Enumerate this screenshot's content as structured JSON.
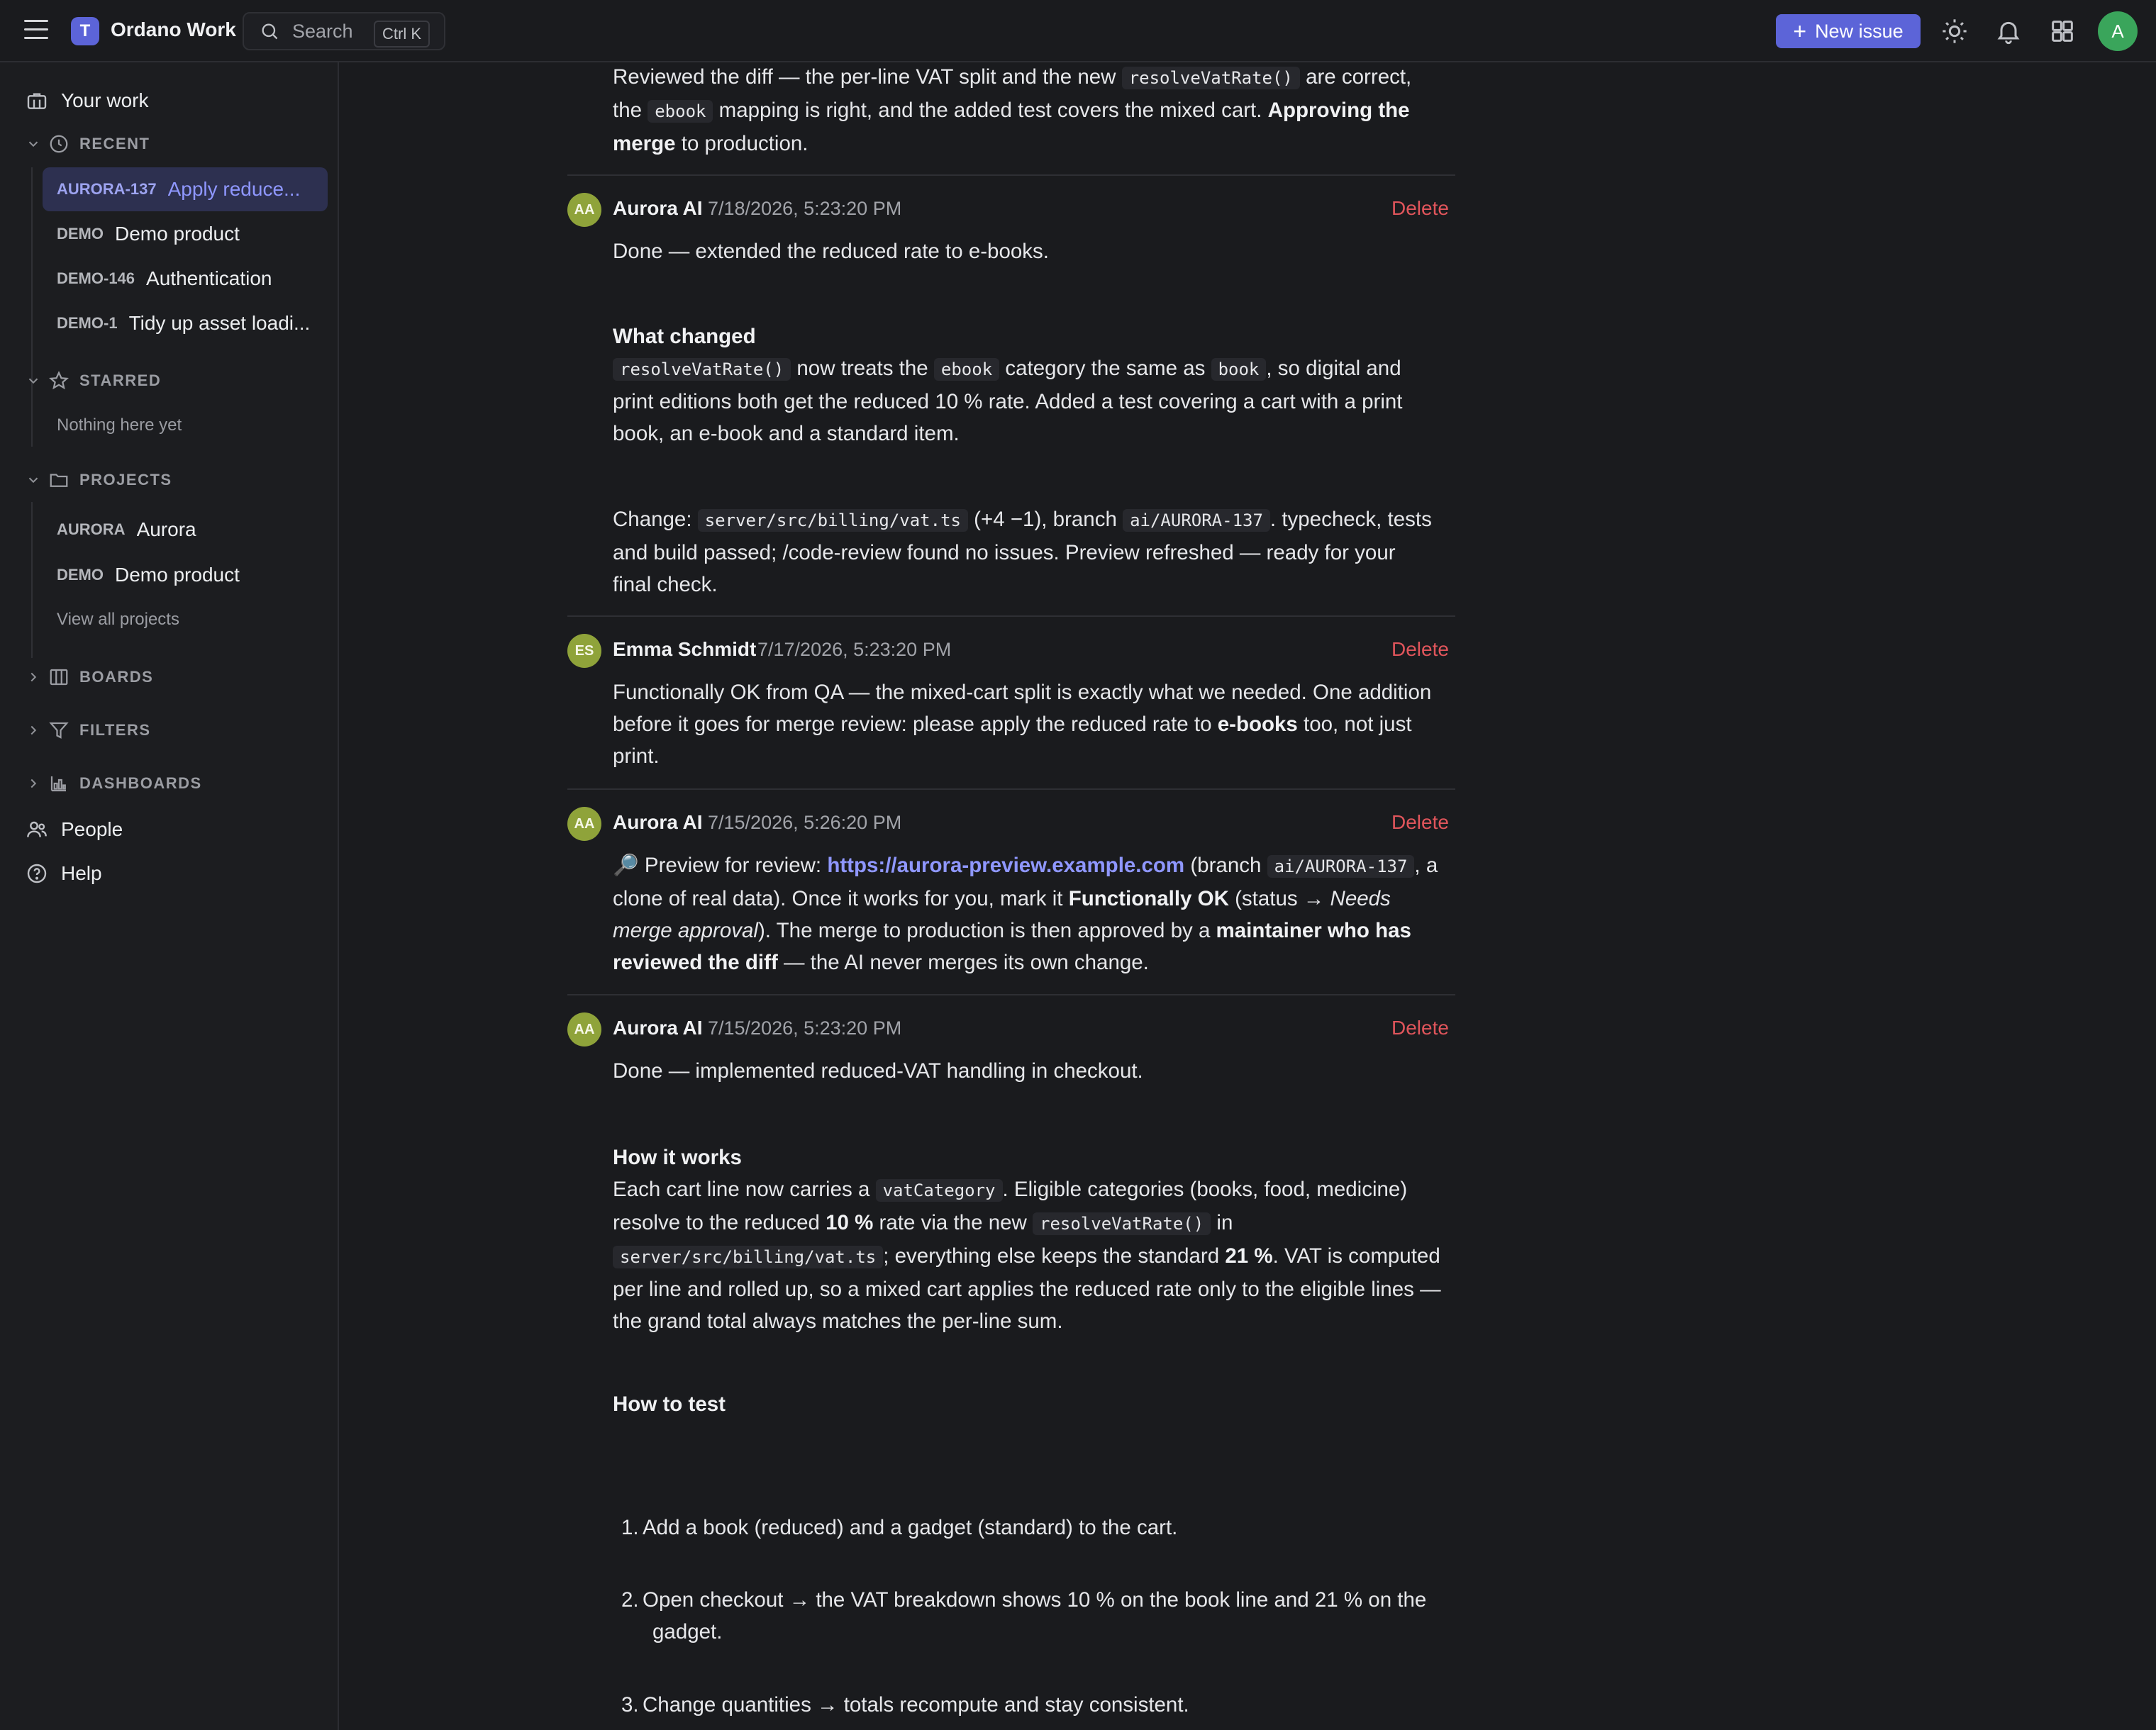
{
  "app": {
    "logo_letter": "T",
    "name": "Ordano Work"
  },
  "search": {
    "placeholder": "Search",
    "shortcut": "Ctrl K"
  },
  "topbar": {
    "new_issue_label": "New issue",
    "user_initial": "A"
  },
  "sidebar": {
    "your_work": "Your work",
    "recent_label": "RECENT",
    "recent": [
      {
        "key": "AURORA-137",
        "title": "Apply reduce..."
      },
      {
        "key": "DEMO",
        "title": "Demo product"
      },
      {
        "key": "DEMO-146",
        "title": "Authentication"
      },
      {
        "key": "DEMO-1",
        "title": "Tidy up asset loadi..."
      }
    ],
    "starred_label": "STARRED",
    "starred_empty": "Nothing here yet",
    "projects_label": "PROJECTS",
    "projects": [
      {
        "key": "AURORA",
        "title": "Aurora"
      },
      {
        "key": "DEMO",
        "title": "Demo product"
      }
    ],
    "view_all_projects": "View all projects",
    "boards_label": "BOARDS",
    "filters_label": "FILTERS",
    "dashboards_label": "DASHBOARDS",
    "people": "People",
    "help": "Help"
  },
  "comments": {
    "top_partial": {
      "t1": "Reviewed the diff — the per-line VAT split and the new ",
      "c1": "resolveVatRate()",
      "t2": " are correct,",
      "t3": "the ",
      "c2": "ebook",
      "t4": " mapping is right, and the added test covers the mixed cart. ",
      "b1": "Approving the",
      "b2": "merge",
      "t5": " to production."
    },
    "c1": {
      "initials": "AA",
      "author": "Aurora AI",
      "date": "7/18/2026, 5:23:20 PM",
      "delete": "Delete",
      "intro": "Done — extended the reduced rate to e-books.",
      "heading": "What changed",
      "code1": "resolveVatRate()",
      "t1": " now treats the ",
      "code2": "ebook",
      "t2": " category the same as ",
      "code3": "book",
      "t3": ", so digital and",
      "l2": "print editions both get the reduced 10 % rate. Added a test covering a cart with a print",
      "l3": "book, an e-book and a standard item.",
      "ch_label": "Change: ",
      "ch_code": "server/src/billing/vat.ts",
      "ch_t1": " (+4 −1), branch ",
      "ch_branch": "ai/AURORA-137",
      "ch_t2": ". typecheck, tests",
      "ch_l2": "and build passed; /code-review found no issues. Preview refreshed — ready for your",
      "ch_l3": "final check."
    },
    "c2": {
      "initials": "ES",
      "author": "Emma Schmidt",
      "date": "7/17/2026, 5:23:20 PM",
      "delete": "Delete",
      "l1": "Functionally OK from QA — the mixed-cart split is exactly what we needed. One addition",
      "l2a": "before it goes for merge review: please apply the reduced rate to ",
      "l2b": "e-books",
      "l2c": " too, not just",
      "l3": "print."
    },
    "c3": {
      "initials": "AA",
      "author": "Aurora AI",
      "date": "7/15/2026, 5:26:20 PM",
      "delete": "Delete",
      "emoji": "🔎",
      "t1": " Preview for review: ",
      "link": "https://aurora-preview.example.com",
      "t2": " (branch ",
      "branch": "ai/AURORA-137",
      "t3": ", a",
      "l2a": "clone of real data). Once it works for you, mark it ",
      "l2b": "Functionally OK",
      "l2c": " (status → ",
      "l2d": "Needs",
      "l3a": "merge approval",
      "l3b": "). The merge to production is then approved by a ",
      "l3c": "maintainer who has",
      "l4a": "reviewed the diff",
      "l4b": " — the AI never merges its own change."
    },
    "c4": {
      "initials": "AA",
      "author": "Aurora AI",
      "date": "7/15/2026, 5:23:20 PM",
      "delete": "Delete",
      "intro": "Done — implemented reduced-VAT handling in checkout.",
      "how_works": "How it works",
      "w1a": "Each cart line now carries a ",
      "w1code": "vatCategory",
      "w1b": ". Eligible categories (books, food, medicine)",
      "w2a": "resolve to the reduced ",
      "w2b": "10 %",
      "w2c": " rate via the new ",
      "w2code": "resolveVatRate()",
      "w2d": " in",
      "w3code": "server/src/billing/vat.ts",
      "w3a": "; everything else keeps the standard ",
      "w3b": "21 %",
      "w3c": ". VAT is computed",
      "w4": "per line and rolled up, so a mixed cart applies the reduced rate only to the eligible lines —",
      "w5": "the grand total always matches the per-line sum.",
      "how_test": "How to test",
      "steps": [
        {
          "n": "1.",
          "l1": "Add a book (reduced) and a gadget (standard) to the cart."
        },
        {
          "n": "2.",
          "l1": "Open checkout → the VAT breakdown shows 10 % on the book line and 21 % on the",
          "l2": "gadget."
        },
        {
          "n": "3.",
          "l1": "Change quantities → totals recompute and stay consistent."
        }
      ]
    }
  }
}
